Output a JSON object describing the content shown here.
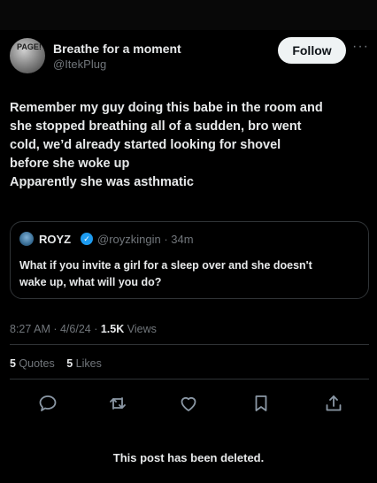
{
  "post": {
    "author": {
      "name": "Breathe for a moment",
      "handle": "@ItekPlug",
      "avatar_text": "PAGE!"
    },
    "follow_label": "Follow",
    "more_icon": "more-horizontal-icon",
    "text_lines": [
      "Remember my guy doing this babe in the room and",
      "she stopped breathing all of a sudden, bro went",
      "cold, we’d already started looking for shovel",
      "before she woke up",
      "Apparently she was asthmatic"
    ],
    "quote": {
      "author_name": "ROYZ",
      "verified_icon": "verified-badge-icon",
      "handle_time": "@royzkingin · 34m",
      "text_lines": [
        "What if you invite a girl for a sleep over and she doesn't",
        "wake up, what will you do?"
      ]
    },
    "meta": {
      "time_date": "8:27 AM · 4/6/24 · ",
      "views_count": "1.5K",
      "views_label": " Views"
    },
    "stats": {
      "quotes_count": "5",
      "quotes_label": " Quotes",
      "likes_count": "5",
      "likes_label": " Likes"
    },
    "actions": [
      "reply-icon",
      "repost-icon",
      "like-icon",
      "bookmark-icon",
      "share-icon"
    ],
    "deleted_notice": "This post has been deleted."
  },
  "colors": {
    "background": "#000000",
    "text_primary": "#e7e9ea",
    "text_secondary": "#71767b",
    "border": "#2f3336",
    "follow_button_bg": "#eff3f4",
    "verified_blue": "#1d9bf0"
  }
}
